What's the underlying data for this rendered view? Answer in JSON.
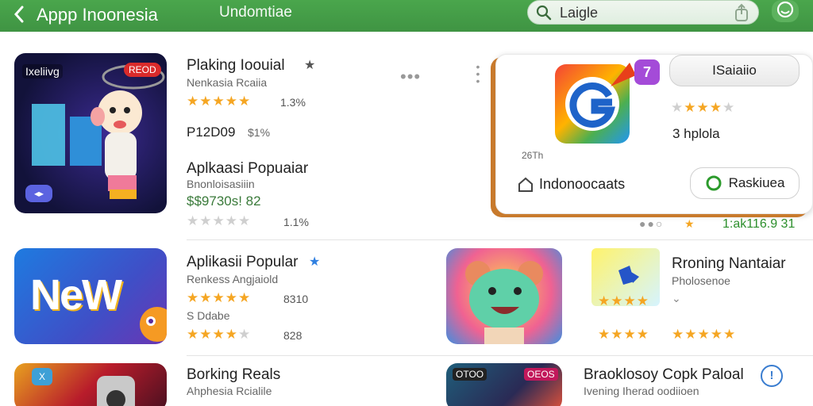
{
  "header": {
    "title": "Appp Inoonesia",
    "subtitle": "Undomtiae",
    "search_text": "Laigle"
  },
  "colors": {
    "brand_green": "#45a047",
    "star": "#f5a623"
  },
  "list": [
    {
      "title": "Plaking Ioouial",
      "subtitle": "Nenkasia Rcaiia",
      "rating_text": "1.3%",
      "price": "P12D09",
      "price2": "$1%",
      "stars": 4.5,
      "icon_badge": "Ixeliivg",
      "icon_badge2": "REOD"
    },
    {
      "title": "Aplkaasi Popuaiar",
      "subtitle": "Bnonloisasiiin",
      "price": "$$9730s! 82",
      "stars": 0,
      "rating_text": "1.1%"
    },
    {
      "title": "Aplikasii Popular",
      "subtitle": "Renkess Angjaiold",
      "stars": 4.5,
      "rating_text": "8310",
      "price_sub": "S Ddabe",
      "stars2": 4,
      "rating_text2": "828",
      "icon_text": "NeW"
    },
    {
      "title": "Borking Reals",
      "subtitle": "Ahphesia Rcialile",
      "icon_badge": "X"
    }
  ],
  "featured": {
    "badge": "7",
    "action": "ISaiaiio",
    "stars": 3.5,
    "price": "3 hplola",
    "small": "26Th",
    "location": "Indonoocaats",
    "cta": "Raskiuea",
    "footer_num": "1:ak116.9 31"
  },
  "right_list": [
    {
      "title": "Rroning Nantaiar",
      "subtitle": "Pholosenoe",
      "stars": 4,
      "stars2": 4
    },
    {
      "title": "Braoklosoy Copk Paloal",
      "subtitle": "Ivening Iherad oodiioen",
      "badge": "OEOS",
      "badge2": "OTOO"
    }
  ]
}
